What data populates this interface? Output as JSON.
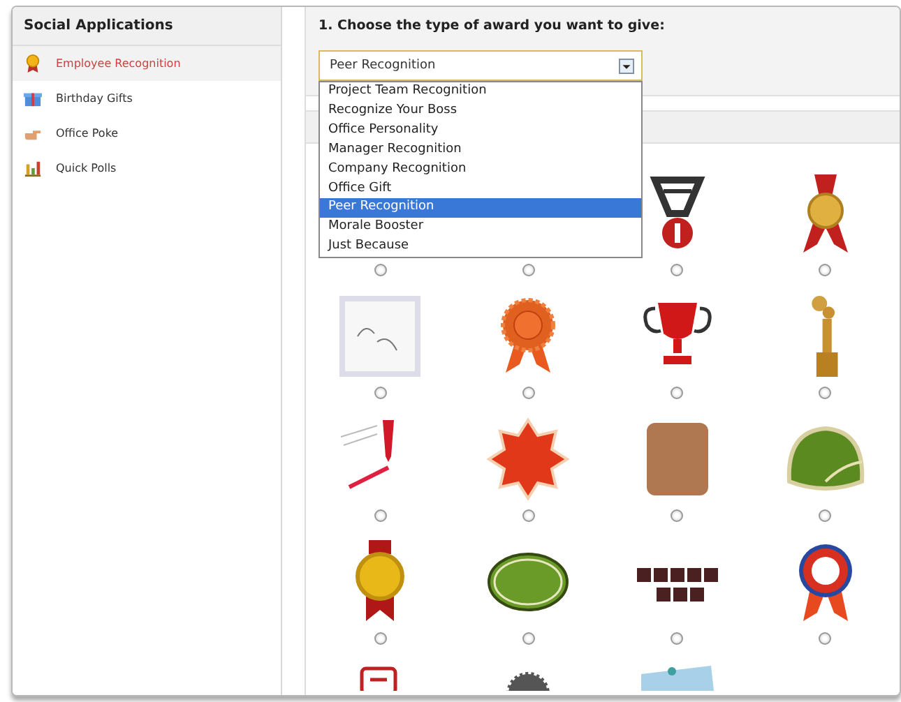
{
  "sidebar": {
    "title": "Social Applications",
    "items": [
      {
        "label": "Employee Recognition",
        "selected": true
      },
      {
        "label": "Birthday Gifts",
        "selected": false
      },
      {
        "label": "Office Poke",
        "selected": false
      },
      {
        "label": "Quick Polls",
        "selected": false
      }
    ]
  },
  "step": {
    "heading": "1. Choose the type of award you want to give:",
    "select": {
      "value": "Peer Recognition",
      "expanded": true,
      "options": [
        {
          "label": "Project Team Recognition",
          "selected": false
        },
        {
          "label": "Recognize Your Boss",
          "selected": false
        },
        {
          "label": "Office Personality",
          "selected": false
        },
        {
          "label": "Manager Recognition",
          "selected": false
        },
        {
          "label": "Company Recognition",
          "selected": false
        },
        {
          "label": "Office Gift",
          "selected": false
        },
        {
          "label": "Peer Recognition",
          "selected": true
        },
        {
          "label": "Morale Booster",
          "selected": false
        },
        {
          "label": "Just Because",
          "selected": false
        }
      ]
    }
  },
  "awards": [
    {
      "kind": "covered",
      "selected": false
    },
    {
      "kind": "covered",
      "selected": false
    },
    {
      "kind": "number-medal",
      "selected": false
    },
    {
      "kind": "gold-medal",
      "selected": false
    },
    {
      "kind": "note",
      "selected": false
    },
    {
      "kind": "orange-rosette",
      "selected": false
    },
    {
      "kind": "trophy",
      "selected": false
    },
    {
      "kind": "statuette",
      "selected": false
    },
    {
      "kind": "pen-note",
      "selected": false
    },
    {
      "kind": "star-badge",
      "selected": false
    },
    {
      "kind": "thumbs-up",
      "selected": false
    },
    {
      "kind": "green-dome",
      "selected": false
    },
    {
      "kind": "gold-ribbon",
      "selected": false
    },
    {
      "kind": "green-oval",
      "selected": false
    },
    {
      "kind": "tiles",
      "selected": false
    },
    {
      "kind": "blue-rosette",
      "selected": false
    }
  ],
  "partial_awards": [
    {
      "kind": "frame"
    },
    {
      "kind": "gear"
    },
    {
      "kind": "photo-card"
    }
  ]
}
